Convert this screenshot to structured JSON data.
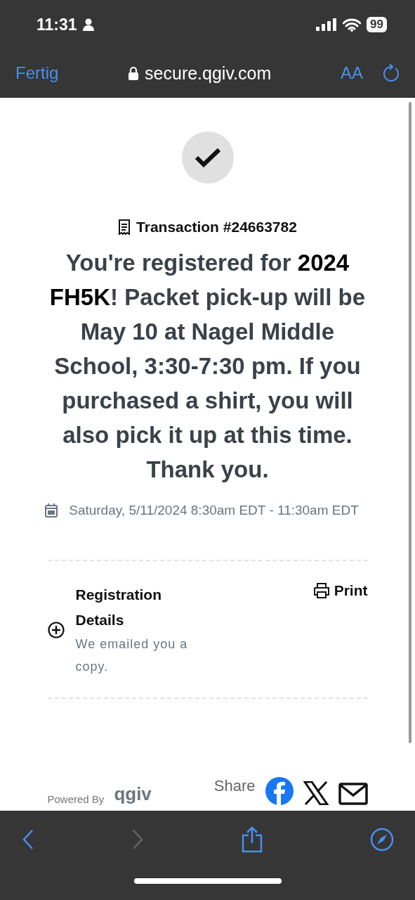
{
  "status_bar": {
    "time": "11:31",
    "battery": "99"
  },
  "browser_bar": {
    "done": "Fertig",
    "url": "secure.qgiv.com",
    "text_size": "AA"
  },
  "confirmation": {
    "transaction": "Transaction #24663782",
    "message": "You're registered for **2024 FH5K**! Packet pick-up will be May 10 at Nagel Middle School, 3:30-7:30 pm. If you purchased a shirt, you will also pick it up at this time. Thank you.",
    "date": "Saturday, 5/11/2024 8:30am EDT - 11:30am EDT"
  },
  "registration_details": {
    "title": "Registration Details",
    "note": "We emailed you a copy.",
    "expanded": false,
    "print": "Print"
  },
  "footer": {
    "powered_by": "Powered By",
    "logo": "qgiv",
    "share": "Share"
  },
  "toolbar": {
    "back_disabled": false,
    "forward_disabled": true
  }
}
